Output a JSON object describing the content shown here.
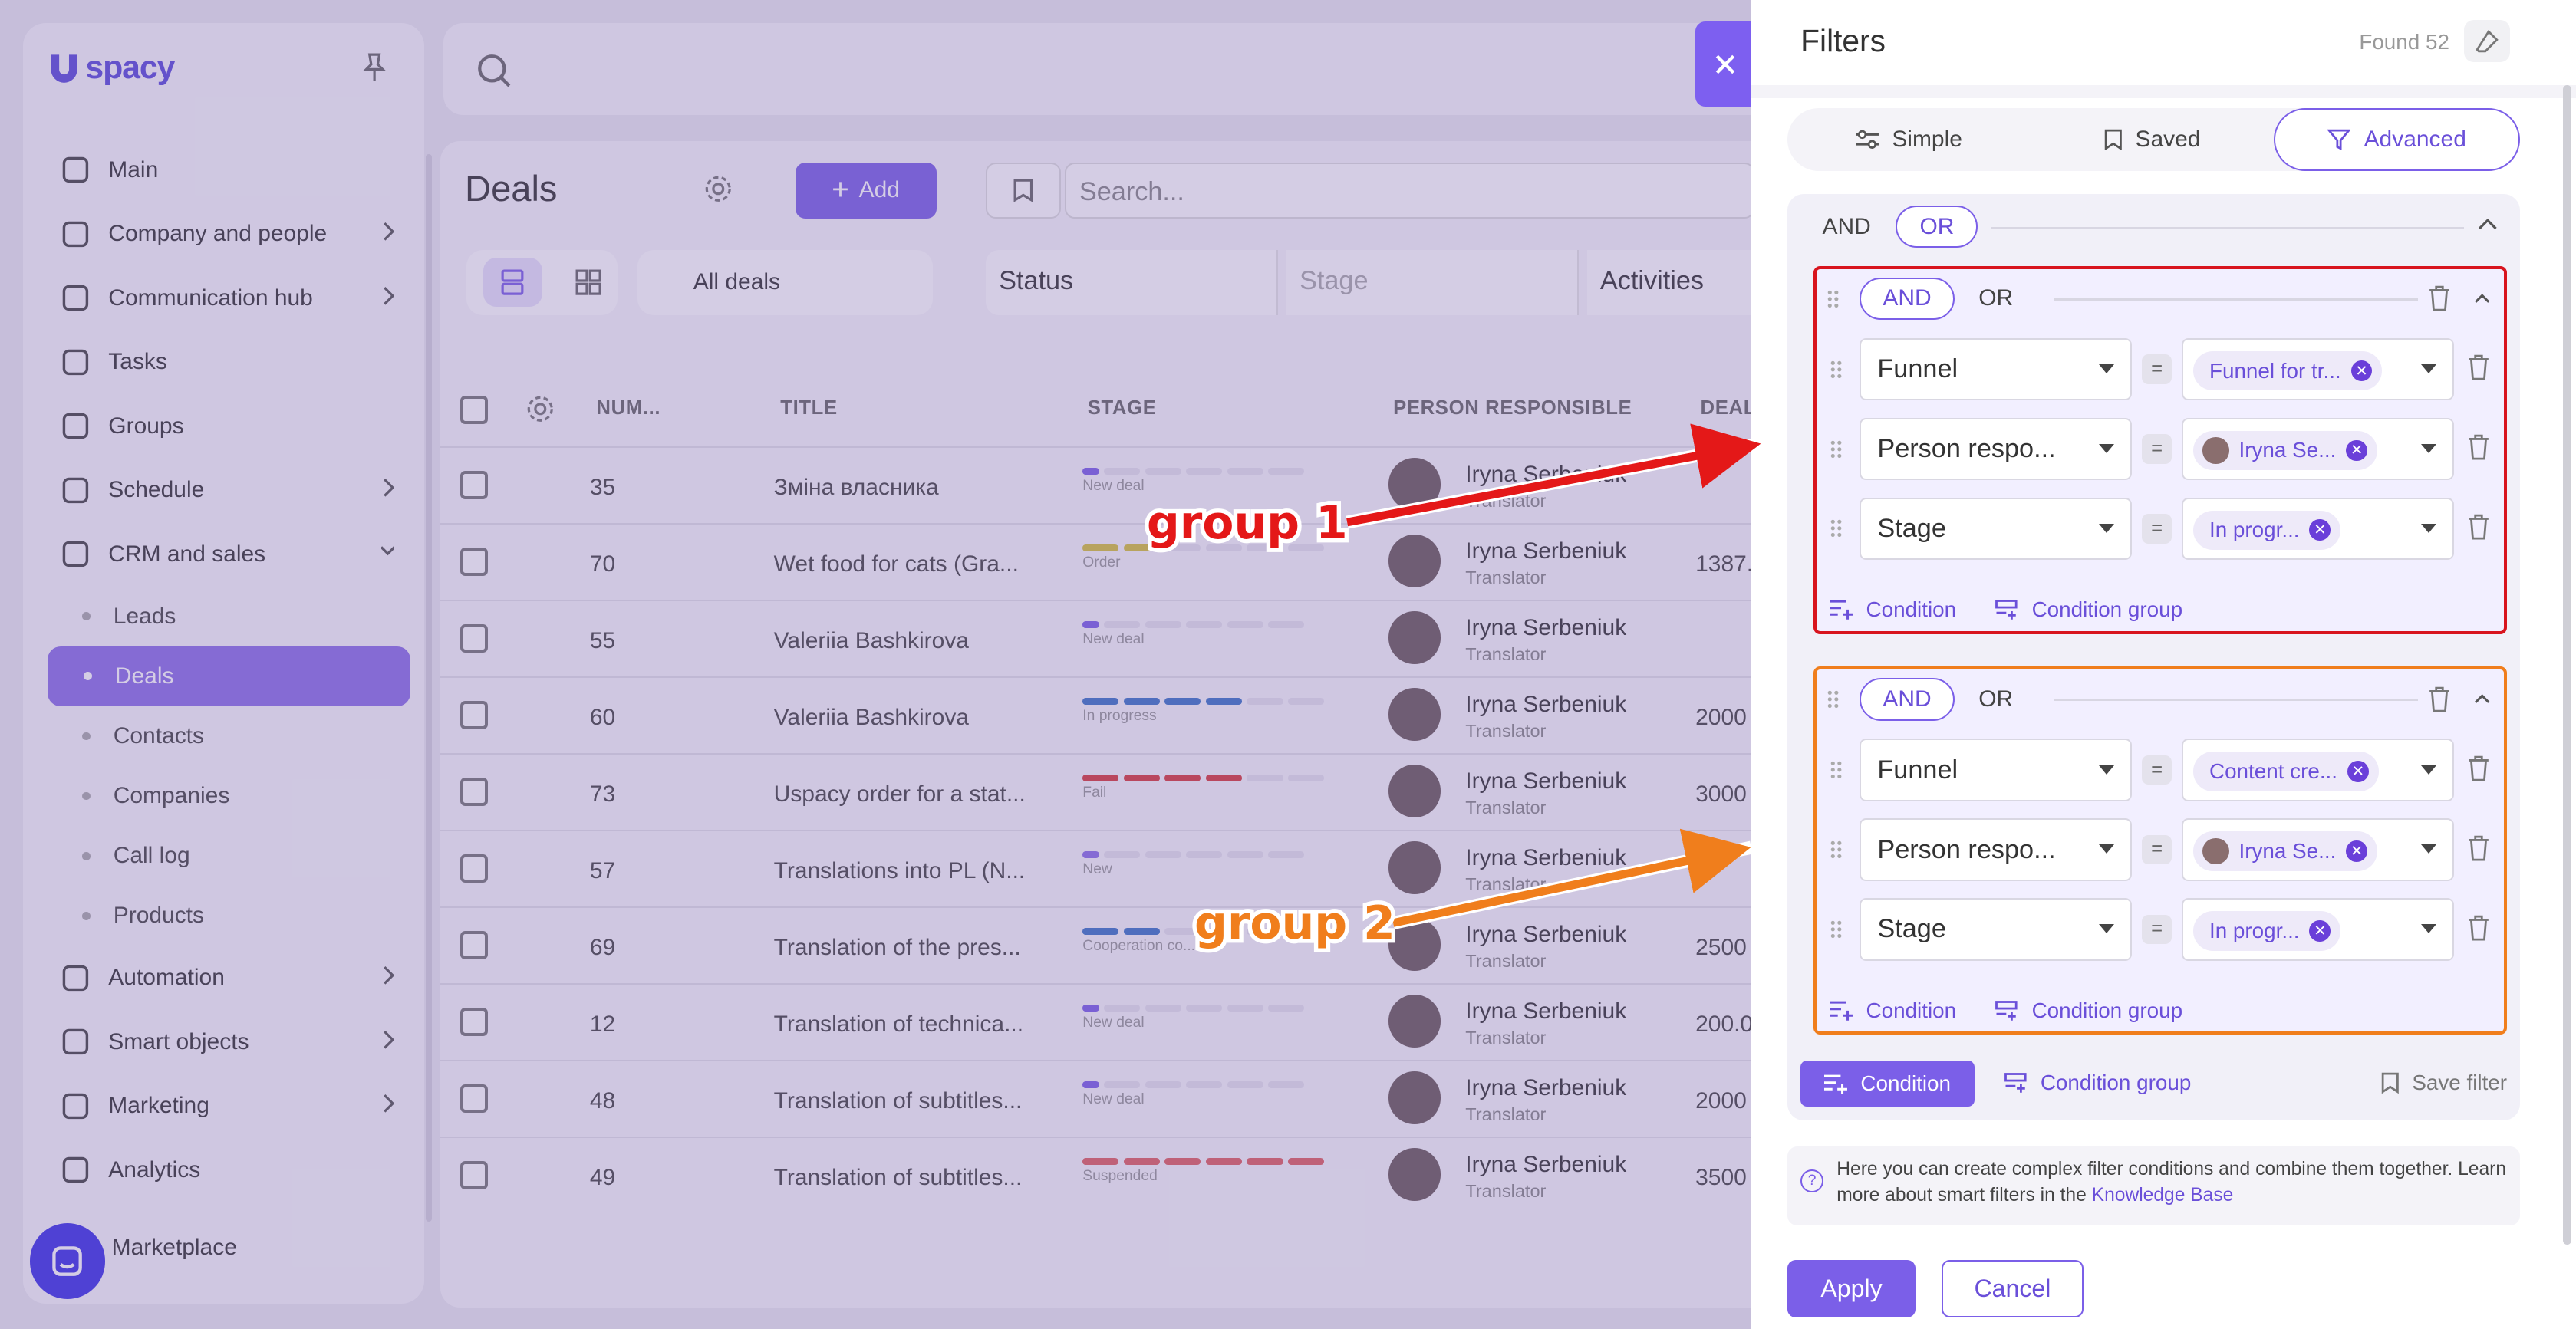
{
  "sidebar": {
    "logo": "spacy",
    "items": [
      {
        "label": "Main",
        "icon": "home-icon"
      },
      {
        "label": "Company and people",
        "icon": "building-icon",
        "chevron": true
      },
      {
        "label": "Communication hub",
        "icon": "chat-edit-icon",
        "chevron": true
      },
      {
        "label": "Tasks",
        "icon": "check-circle-icon"
      },
      {
        "label": "Groups",
        "icon": "people-icon"
      },
      {
        "label": "Schedule",
        "icon": "calendar-icon",
        "chevron": true
      },
      {
        "label": "CRM and sales",
        "icon": "database-icon",
        "chevron": true,
        "expanded": true
      }
    ],
    "crm_sub": [
      "Leads",
      "Deals",
      "Contacts",
      "Companies",
      "Call log",
      "Products"
    ],
    "items_after": [
      {
        "label": "Automation",
        "icon": "bolt-icon",
        "chevron": true
      },
      {
        "label": "Smart objects",
        "icon": "scan-icon",
        "chevron": true
      },
      {
        "label": "Marketing",
        "icon": "megaphone-icon",
        "chevron": true
      },
      {
        "label": "Analytics",
        "icon": "chart-icon"
      }
    ],
    "marketplace": "Marketplace"
  },
  "main": {
    "title": "Deals",
    "add_label": "Add",
    "search_placeholder": "Search...",
    "deals_select": "All deals",
    "filters": {
      "status": "Status",
      "stage": "Stage",
      "activities": "Activities"
    },
    "columns": [
      "NUM...",
      "TITLE",
      "STAGE",
      "PERSON RESPONSIBLE",
      "DEAL"
    ],
    "rows": [
      {
        "num": "35",
        "title": "Зміна власника",
        "stage": "New deal",
        "stage_bars": [
          1,
          0,
          0,
          0,
          0,
          0
        ],
        "color": "#7b5fe8",
        "person": "Iryna Serbeniuk",
        "role": "Translator",
        "amount": ""
      },
      {
        "num": "70",
        "title": "Wet food for cats (Gra...",
        "stage": "Order",
        "stage_bars": [
          2,
          0,
          0,
          0,
          0,
          0
        ],
        "color": "#d6c23a",
        "person": "Iryna Serbeniuk",
        "role": "Translator",
        "amount": "1387."
      },
      {
        "num": "55",
        "title": "Valeriia Bashkirova",
        "stage": "New deal",
        "stage_bars": [
          1,
          0,
          0,
          0,
          0,
          0
        ],
        "color": "#7b5fe8",
        "person": "Iryna Serbeniuk",
        "role": "Translator",
        "amount": ""
      },
      {
        "num": "60",
        "title": "Valeriia Bashkirova",
        "stage": "In progress",
        "stage_bars": [
          4,
          0
        ],
        "color": "#3b74c8",
        "person": "Iryna Serbeniuk",
        "role": "Translator",
        "amount": "2000"
      },
      {
        "num": "73",
        "title": "Uspacy order for a stat...",
        "stage": "Fail",
        "stage_bars": [
          4
        ],
        "color": "#d83a3a",
        "person": "Iryna Serbeniuk",
        "role": "Translator",
        "amount": "3000"
      },
      {
        "num": "57",
        "title": "Translations into PL (N...",
        "stage": "New",
        "stage_bars": [
          1,
          0,
          0,
          0
        ],
        "color": "#8b6fe8",
        "person": "Iryna Serbeniuk",
        "role": "Translator",
        "amount": ""
      },
      {
        "num": "69",
        "title": "Translation of the pres...",
        "stage": "Cooperation co...",
        "stage_bars": [
          2,
          0,
          0
        ],
        "color": "#3b74c8",
        "person": "Iryna Serbeniuk",
        "role": "Translator",
        "amount": "2500"
      },
      {
        "num": "12",
        "title": "Translation of technica...",
        "stage": "New deal",
        "stage_bars": [
          1,
          0,
          0,
          0,
          0,
          0
        ],
        "color": "#7b5fe8",
        "person": "Iryna Serbeniuk",
        "role": "Translator",
        "amount": "200.0"
      },
      {
        "num": "48",
        "title": "Translation of subtitles...",
        "stage": "New deal",
        "stage_bars": [
          1,
          0,
          0,
          0,
          0,
          0
        ],
        "color": "#7b5fe8",
        "person": "Iryna Serbeniuk",
        "role": "Translator",
        "amount": "2000"
      },
      {
        "num": "49",
        "title": "Translation of subtitles...",
        "stage": "Suspended",
        "stage_bars": [
          8,
          0
        ],
        "color": "#e06060",
        "person": "Iryna Serbeniuk",
        "role": "Translator",
        "amount": "3500"
      }
    ]
  },
  "panel": {
    "title": "Filters",
    "found": "Found 52",
    "tabs": [
      {
        "label": "Simple"
      },
      {
        "label": "Saved"
      },
      {
        "label": "Advanced",
        "active": true
      }
    ],
    "outer_ops": [
      "AND",
      "OR"
    ],
    "outer_selected": "OR",
    "groups": [
      {
        "ops": [
          "AND",
          "OR"
        ],
        "selected": "AND",
        "conditions": [
          {
            "field": "Funnel",
            "value": "Funnel for tr...",
            "avatar": false
          },
          {
            "field": "Person respo...",
            "value": "Iryna Se...",
            "avatar": true
          },
          {
            "field": "Stage",
            "value": "In progr...",
            "avatar": false
          }
        ],
        "condition_label": "Condition",
        "group_label": "Condition group"
      },
      {
        "ops": [
          "AND",
          "OR"
        ],
        "selected": "AND",
        "conditions": [
          {
            "field": "Funnel",
            "value": "Content cre...",
            "avatar": false
          },
          {
            "field": "Person respo...",
            "value": "Iryna Se...",
            "avatar": true
          },
          {
            "field": "Stage",
            "value": "In progr...",
            "avatar": false
          }
        ],
        "condition_label": "Condition",
        "group_label": "Condition group"
      }
    ],
    "condition_btn": "Condition",
    "condition_group_btn": "Condition group",
    "save_filter": "Save filter",
    "info_text": "Here you can create complex filter conditions and combine them together. Learn more about smart filters in the",
    "info_link": "Knowledge Base",
    "apply": "Apply",
    "cancel": "Cancel"
  },
  "annotations": {
    "group1": "group 1",
    "group2": "group 2"
  },
  "colors": {
    "accent": "#7b5fe8",
    "group1_border": "#d8141e",
    "group2_border": "#f07e1c"
  }
}
